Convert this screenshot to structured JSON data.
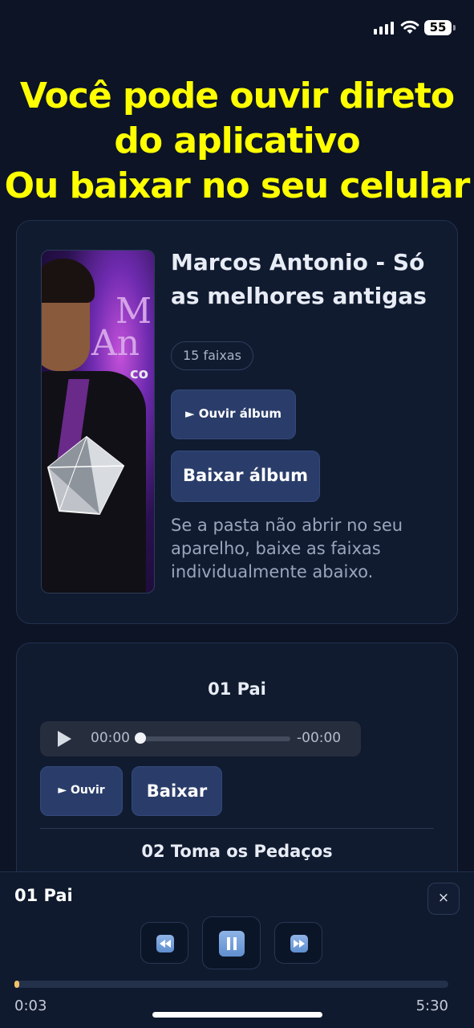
{
  "status_bar": {
    "battery": "55"
  },
  "headline": {
    "line1": "Você pode ouvir direto",
    "line2": "do aplicativo",
    "line3": "Ou baixar no seu celular"
  },
  "album": {
    "cover_text_line1": "M",
    "cover_text_line2": "An",
    "cover_text_line3": "co",
    "title": "Marcos Antonio - Só as melhores antigas",
    "track_count": "15 faixas",
    "listen_button": "► Ouvir álbum",
    "download_button": "Baixar álbum",
    "note": "Se a pasta não abrir no seu aparelho, baixe as faixas individualmente abaixo."
  },
  "tracks": [
    {
      "title": "01 Pai",
      "audio_current": "00:00",
      "audio_remaining": "-00:00",
      "listen_label": "► Ouvir",
      "download_label": "Baixar"
    },
    {
      "title": "02 Toma os Pedaços"
    }
  ],
  "player": {
    "now_playing": "01 Pai",
    "close_label": "×",
    "current_time": "0:03",
    "total_time": "5:30",
    "progress_fraction": 0.009,
    "accent": "#f2c26b",
    "icons": {
      "prev": "rewind-icon",
      "pause": "pause-icon",
      "next": "fast-forward-icon"
    }
  }
}
